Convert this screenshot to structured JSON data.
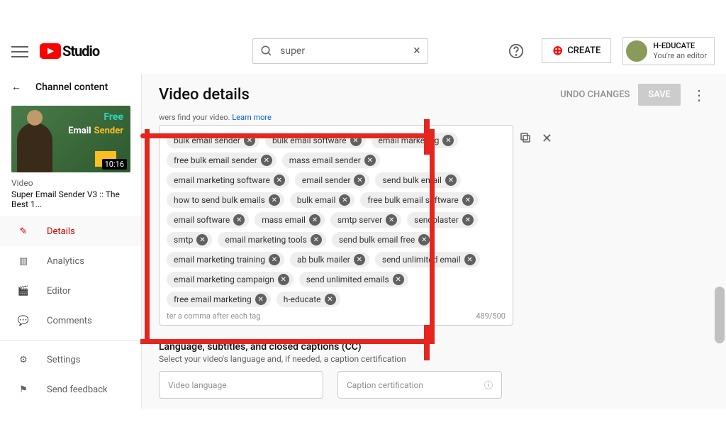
{
  "header": {
    "logo_text": "Studio",
    "search_value": "super",
    "create_label": "CREATE",
    "account_name": "H-EDUCATE",
    "account_role": "You're an editor"
  },
  "sidebar": {
    "back_label": "Channel content",
    "video_label": "Video",
    "video_title": "Super Email Sender V3 :: The Best 1...",
    "duration": "10:16",
    "thumb_line1": "Free",
    "thumb_line2": "Email",
    "thumb_line3": "Sender",
    "nav": [
      {
        "icon": "pencil",
        "label": "Details",
        "active": true
      },
      {
        "icon": "bars",
        "label": "Analytics",
        "active": false
      },
      {
        "icon": "film",
        "label": "Editor",
        "active": false
      },
      {
        "icon": "comment",
        "label": "Comments",
        "active": false
      }
    ],
    "footer": [
      {
        "icon": "gear",
        "label": "Settings"
      },
      {
        "icon": "flag",
        "label": "Send feedback"
      }
    ]
  },
  "main": {
    "title": "Video details",
    "undo_label": "UNDO CHANGES",
    "save_label": "SAVE",
    "tags_hint_prefix": "wers find your video. ",
    "tags_learn_more": "Learn more",
    "tags": [
      "bulk email sender",
      "bulk email software",
      "email marketing",
      "free bulk email sender",
      "mass email sender",
      "email marketing software",
      "email sender",
      "send bulk email",
      "how to send bulk emails",
      "bulk email",
      "free bulk email software",
      "email software",
      "mass email",
      "smtp server",
      "sendblaster",
      "smtp",
      "email marketing tools",
      "send bulk email free",
      "email marketing training",
      "ab bulk mailer",
      "send unlimited email",
      "email marketing campaign",
      "send unlimited emails",
      "free email marketing",
      "h-educate"
    ],
    "tag_input_placeholder": "ter a comma after each tag",
    "tag_counter": "489/500",
    "lang_title": "Language, subtitles, and closed captions (CC)",
    "lang_desc": "Select your video's language and, if needed, a caption certification",
    "lang_select": "Video language",
    "cert_select": "Caption certification"
  }
}
